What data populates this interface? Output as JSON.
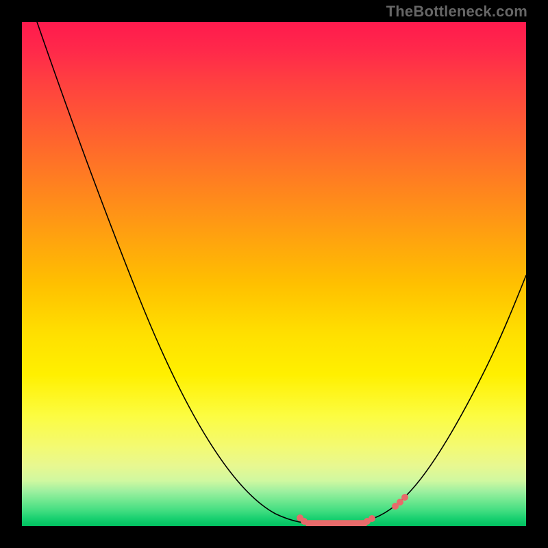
{
  "watermark": "TheBottleneck.com",
  "colors": {
    "frame_bg": "#000000",
    "marker": "#e86a6a",
    "curve": "#000000"
  },
  "chart_data": {
    "type": "line",
    "title": "",
    "xlabel": "",
    "ylabel": "",
    "xlim": [
      0,
      1
    ],
    "ylim": [
      0,
      1
    ],
    "x": [
      0.03,
      0.06,
      0.1,
      0.15,
      0.2,
      0.25,
      0.3,
      0.35,
      0.4,
      0.45,
      0.5,
      0.55,
      0.58,
      0.62,
      0.66,
      0.7,
      0.73,
      0.76,
      0.8,
      0.85,
      0.9,
      0.95,
      1.0
    ],
    "values": [
      1.0,
      0.92,
      0.82,
      0.7,
      0.58,
      0.47,
      0.37,
      0.28,
      0.2,
      0.13,
      0.07,
      0.025,
      0.012,
      0.005,
      0.003,
      0.006,
      0.015,
      0.035,
      0.08,
      0.16,
      0.27,
      0.4,
      0.55
    ],
    "highlighted_segment": {
      "x_start": 0.55,
      "x_end": 0.76
    },
    "grid": false,
    "legend": false
  }
}
